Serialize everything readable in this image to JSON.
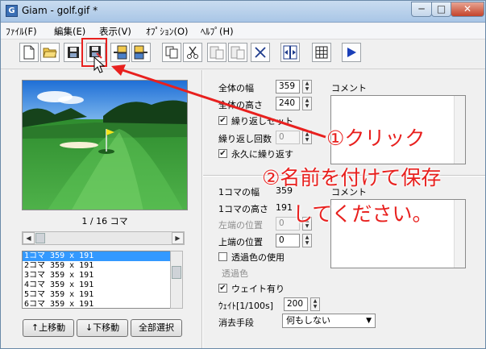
{
  "window": {
    "app_icon": "G",
    "title": "Giam - golf.gif *",
    "controls": {
      "minimize": "─",
      "maximize": "□",
      "close": "✕"
    }
  },
  "menu": [
    {
      "label": "ﾌｧｲﾙ(F)"
    },
    {
      "label": "編集(E)"
    },
    {
      "label": "表示(V)"
    },
    {
      "label": "ｵﾌﾟｼｮﾝ(O)"
    },
    {
      "label": "ﾍﾙﾌﾟ(H)"
    }
  ],
  "toolbar": {
    "buttons": [
      {
        "icon": "new-file-icon"
      },
      {
        "icon": "open-folder-icon"
      },
      {
        "icon": "save-icon"
      },
      {
        "icon": "save-as-icon"
      },
      {
        "icon": "import-frame-icon"
      },
      {
        "icon": "export-frame-icon"
      },
      {
        "icon": "copy-icon"
      },
      {
        "icon": "cut-icon"
      },
      {
        "icon": "paste-before-icon"
      },
      {
        "icon": "paste-after-icon"
      },
      {
        "icon": "delete-icon"
      },
      {
        "icon": "fit-size-icon"
      },
      {
        "icon": "grid-icon"
      },
      {
        "icon": "play-icon"
      }
    ]
  },
  "preview": {
    "frame_counter": "1 / 16 コマ",
    "scroll_left": "◀",
    "scroll_right": "▶"
  },
  "frames": [
    "1コマ 359 x 191",
    "2コマ 359 x 191",
    "3コマ 359 x 191",
    "4コマ 359 x 191",
    "5コマ 359 x 191",
    "6コマ 359 x 191"
  ],
  "frame_buttons": {
    "move_up": "↑上移動",
    "move_down": "↓下移動",
    "select_all": "全部選択"
  },
  "global": {
    "width_label": "全体の幅",
    "width_value": "359",
    "height_label": "全体の高さ",
    "height_value": "240",
    "loop_label": "繰り返しセット",
    "loop_checked": "✔",
    "loop_count_label": "繰り返し回数",
    "loop_count_value": "0",
    "loop_forever_label": "永久に繰り返す",
    "loop_forever_checked": "✔",
    "comment_label": "コメント"
  },
  "frame": {
    "width_label": "1コマの幅",
    "width_value": "359",
    "height_label": "1コマの高さ",
    "height_value": "191",
    "left_label": "左端の位置",
    "left_value": "0",
    "top_label": "上端の位置",
    "top_value": "0",
    "transparent_label": "透過色の使用",
    "transparent_color_label": "透過色",
    "wait_label": "ウェイト有り",
    "wait_checked": "✔",
    "wait_value_label": "ｳｪｲﾄ[1/100s]",
    "wait_value": "200",
    "dispose_label": "消去手段",
    "dispose_value": "何もしない",
    "comment_label": "コメント"
  },
  "annotations": {
    "step1": "①クリック",
    "step2": "②名前を付けて保存",
    "step2_cont": "してください。",
    "color": "#e8201e"
  }
}
